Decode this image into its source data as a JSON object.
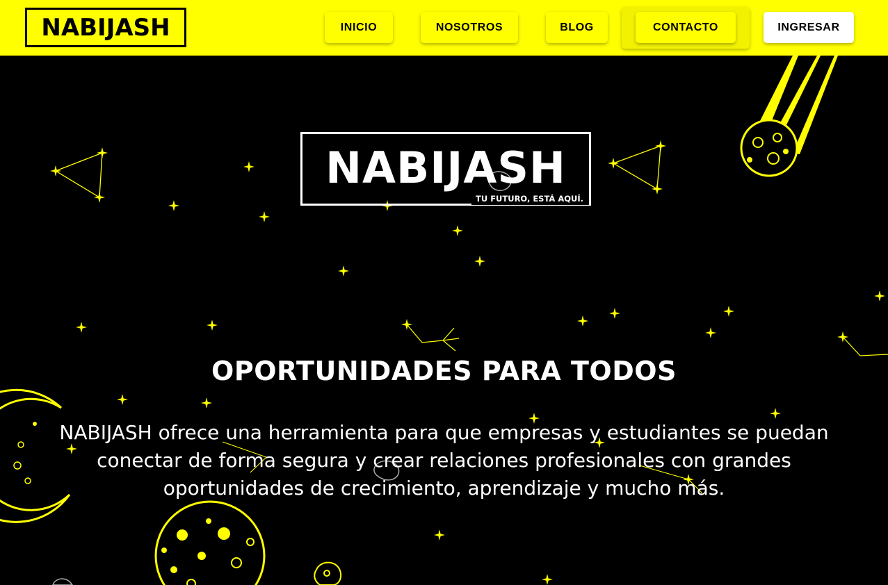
{
  "navbar": {
    "brand": "NABIJASH",
    "items": [
      {
        "label": "INICIO"
      },
      {
        "label": "NOSOTROS"
      },
      {
        "label": "BLOG"
      },
      {
        "label": "CONTACTO"
      }
    ],
    "login_label": "INGRESAR"
  },
  "hero": {
    "logo_text": "NABIJASH",
    "logo_tagline": "TU FUTURO, ESTÁ AQUÍ.",
    "title": "OPORTUNIDADES PARA TODOS",
    "description": "NABIJASH ofrece una herramienta para que empresas y estudiantes se puedan conectar de forma segura y crear relaciones profesionales con grandes oportunidades de crecimiento, aprendizaje y mucho más."
  },
  "colors": {
    "accent": "#ffff00",
    "background": "#000000",
    "text": "#ffffff"
  },
  "icons": [
    "star-icon",
    "constellation-icon",
    "comet-icon",
    "moon-icon",
    "planet-icon",
    "asteroid-icon"
  ]
}
